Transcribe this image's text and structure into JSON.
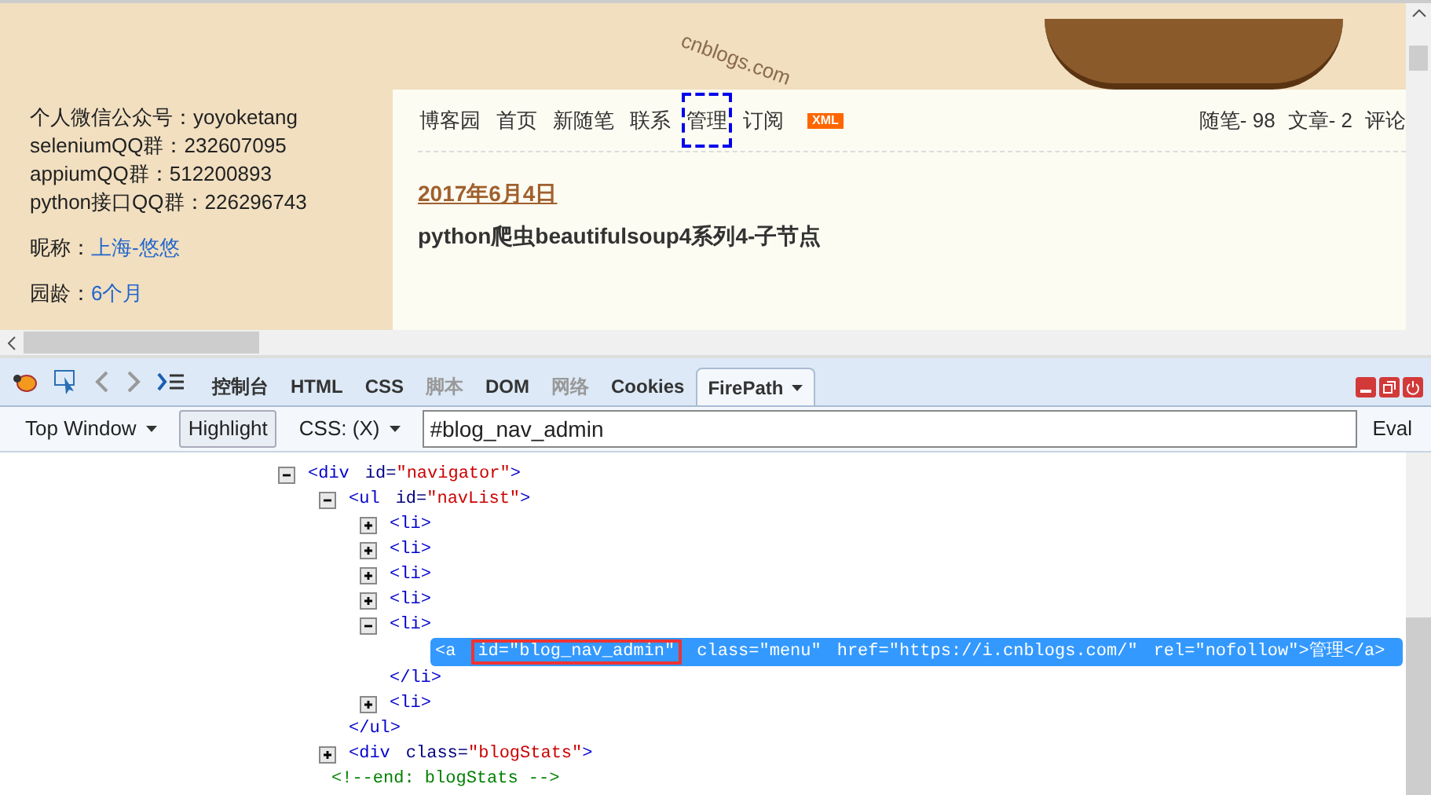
{
  "page": {
    "sidebar": {
      "contact_lines": [
        "个人微信公众号：yoyoketang",
        "seleniumQQ群：232607095",
        "appiumQQ群：512200893",
        "python接口QQ群：226296743"
      ],
      "fields": [
        {
          "label": "昵称：",
          "value": "上海-悠悠"
        },
        {
          "label": "园龄：",
          "value": "6个月"
        }
      ]
    },
    "header_logo": "cnblogs.com",
    "nav": [
      {
        "label": "博客园",
        "focused": false
      },
      {
        "label": "首页",
        "focused": false
      },
      {
        "label": "新随笔",
        "focused": false
      },
      {
        "label": "联系",
        "focused": false
      },
      {
        "label": "管理",
        "focused": true
      },
      {
        "label": "订阅",
        "focused": false
      }
    ],
    "xml_badge": "XML",
    "stats": [
      "随笔- 98",
      "文章- 2",
      "评论"
    ],
    "post_date": "2017年6月4日",
    "post_title": "python爬虫beautifulsoup4系列4-子节点"
  },
  "firebug": {
    "tabs": [
      {
        "label": "控制台",
        "selected": false,
        "disabled": false
      },
      {
        "label": "HTML",
        "selected": false,
        "disabled": false
      },
      {
        "label": "CSS",
        "selected": false,
        "disabled": false
      },
      {
        "label": "脚本",
        "selected": false,
        "disabled": true
      },
      {
        "label": "DOM",
        "selected": false,
        "disabled": false
      },
      {
        "label": "网络",
        "selected": false,
        "disabled": true
      },
      {
        "label": "Cookies",
        "selected": false,
        "disabled": false
      },
      {
        "label": "FirePath",
        "selected": true,
        "disabled": false
      }
    ],
    "firepath": {
      "window_select": "Top Window",
      "highlight": {
        "label": "Highlight",
        "on": true
      },
      "mode_select": "CSS: (X)",
      "query": "#blog_nav_admin",
      "eval": "Eval"
    },
    "tree": [
      {
        "kind": "element",
        "open": "<div",
        "attrs": [
          {
            "name": "id=",
            "value": "\"navigator\""
          }
        ],
        "end": ">",
        "expanded": true,
        "children": [
          {
            "kind": "element",
            "open": "<ul",
            "attrs": [
              {
                "name": "id=",
                "value": "\"navList\""
              }
            ],
            "end": ">",
            "expanded": true,
            "close": "</ul>",
            "children": [
              {
                "kind": "element",
                "open": "<li",
                "end": ">",
                "expanded": false
              },
              {
                "kind": "element",
                "open": "<li",
                "end": ">",
                "expanded": false
              },
              {
                "kind": "element",
                "open": "<li",
                "end": ">",
                "expanded": false
              },
              {
                "kind": "element",
                "open": "<li",
                "end": ">",
                "expanded": false
              },
              {
                "kind": "element",
                "open": "<li",
                "end": ">",
                "expanded": true,
                "close": "</li>",
                "children": [
                  {
                    "kind": "element",
                    "open": "<a",
                    "attrs": [
                      {
                        "name": "id=",
                        "value": "\"blog_nav_admin\"",
                        "boxed": true
                      },
                      {
                        "name": "class=",
                        "value": "\"menu\""
                      },
                      {
                        "name": "href=",
                        "value": "\"https://i.cnblogs.com/\""
                      },
                      {
                        "name": "rel=",
                        "value": "\"nofollow\""
                      }
                    ],
                    "end": ">",
                    "inner": "管理",
                    "close": "</a>",
                    "selected": true
                  }
                ]
              },
              {
                "kind": "element",
                "open": "<li",
                "end": ">",
                "expanded": false
              }
            ]
          },
          {
            "kind": "element",
            "open": "<div",
            "attrs": [
              {
                "name": "class=",
                "value": "\"blogStats\""
              }
            ],
            "end": ">",
            "expanded": false
          },
          {
            "kind": "comment",
            "text": "<!--end: blogStats -->"
          }
        ]
      }
    ]
  }
}
